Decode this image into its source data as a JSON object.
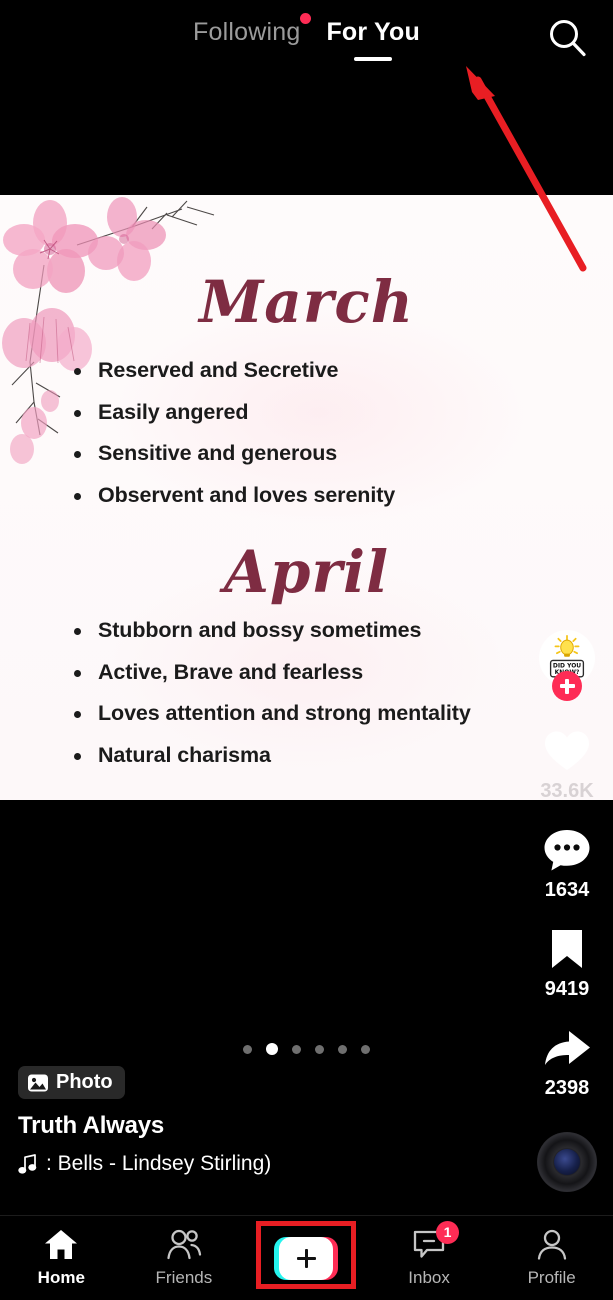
{
  "topbar": {
    "tabs": [
      {
        "label": "Following",
        "active": false,
        "has_dot": true
      },
      {
        "label": "For You",
        "active": true,
        "has_dot": false
      }
    ],
    "search_icon": "search-icon"
  },
  "post": {
    "card": {
      "sections": [
        {
          "title": "March",
          "traits": [
            "Reserved and Secretive",
            "Easily angered",
            "Sensitive and generous",
            "Observent and loves serenity"
          ]
        },
        {
          "title": "April",
          "traits": [
            "Stubborn and bossy sometimes",
            "Active, Brave and fearless",
            "Loves attention and strong mentality",
            "Natural charisma"
          ]
        }
      ],
      "decoration": "cherry-blossom-branch",
      "background_color": "#FDF9FA",
      "title_color": "#7E2C42"
    },
    "rail": {
      "avatar": {
        "name": "avatar",
        "graphic_text_line1": "DID YOU",
        "graphic_text_line2": "KNOW?"
      },
      "follow_label": "+",
      "actions": [
        {
          "icon": "heart-icon",
          "count": "33.6K"
        },
        {
          "icon": "comment-icon",
          "count": "1634"
        },
        {
          "icon": "bookmark-icon",
          "count": "9419"
        },
        {
          "icon": "share-icon",
          "count": "2398"
        }
      ],
      "music_disc": "music-disc-icon"
    },
    "pagination": {
      "total": 6,
      "active_index": 1
    },
    "caption": {
      "badge_label": "Photo",
      "badge_icon": "photo-icon",
      "username": "Truth Always",
      "music_icon": "music-note-icon",
      "music_text": ": Bells - Lindsey Stirling)"
    }
  },
  "bottomnav": {
    "items": [
      {
        "label": "Home",
        "icon": "home-icon",
        "active": true,
        "badge": ""
      },
      {
        "label": "Friends",
        "icon": "friends-icon",
        "active": false,
        "badge": ""
      },
      {
        "label": "",
        "icon": "create-icon",
        "active": false,
        "badge": ""
      },
      {
        "label": "Inbox",
        "icon": "inbox-icon",
        "active": false,
        "badge": "1"
      },
      {
        "label": "Profile",
        "icon": "profile-icon",
        "active": false,
        "badge": ""
      }
    ]
  },
  "annotations": {
    "arrow_color": "#E81E23",
    "box_color": "#E81E23",
    "arrow_target": "for-you-tab",
    "box_target": "create-button"
  }
}
